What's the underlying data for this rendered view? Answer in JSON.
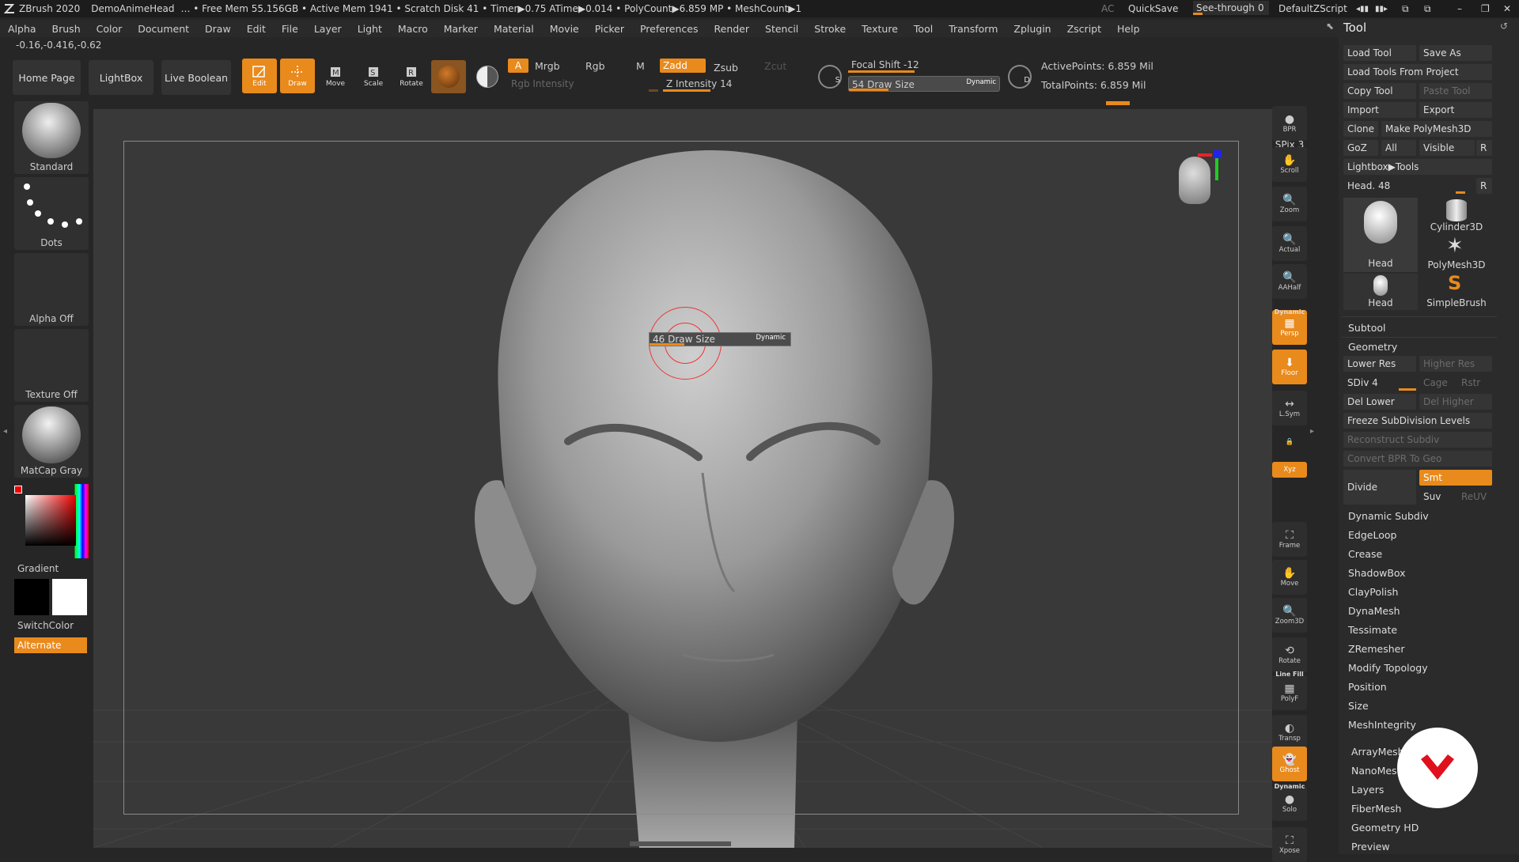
{
  "titlebar": {
    "app": "ZBrush 2020",
    "doc": "DemoAnimeHead",
    "stats": "… • Free Mem 55.156GB • Active Mem 1941 • Scratch Disk 41 • Timer▶0.75 ATime▶0.014 • PolyCount▶6.859 MP • MeshCount▶1",
    "ac": "AC",
    "quicksave": "QuickSave",
    "seethrough": "See-through",
    "seethrough_value": "0",
    "script": "DefaultZScript"
  },
  "menu": [
    "Alpha",
    "Brush",
    "Color",
    "Document",
    "Draw",
    "Edit",
    "File",
    "Layer",
    "Light",
    "Macro",
    "Marker",
    "Material",
    "Movie",
    "Picker",
    "Preferences",
    "Render",
    "Stencil",
    "Stroke",
    "Texture",
    "Tool",
    "Transform",
    "Zplugin",
    "Zscript",
    "Help"
  ],
  "coords": "-0.16,-0.416,-0.62",
  "shelf": {
    "home": "Home Page",
    "lightbox": "LightBox",
    "liveboolean": "Live Boolean",
    "edit": "Edit",
    "draw": "Draw",
    "move": "Move",
    "scale": "Scale",
    "rotate": "Rotate",
    "a": "A",
    "mrgb": "Mrgb",
    "rgb": "Rgb",
    "m": "M",
    "zadd": "Zadd",
    "zsub": "Zsub",
    "zcut": "Zcut",
    "rgb_intensity": "Rgb Intensity",
    "z_intensity": "Z Intensity 14",
    "focal_shift": "Focal Shift -12",
    "draw_size": "54 Draw Size",
    "dynamic": "Dynamic",
    "active_points": "ActivePoints: 6.859 Mil",
    "total_points": "TotalPoints: 6.859 Mil",
    "s": "S",
    "d": "D"
  },
  "left": {
    "standard": "Standard",
    "dots": "Dots",
    "alpha_off": "Alpha Off",
    "texture_off": "Texture Off",
    "matcap": "MatCap Gray",
    "gradient": "Gradient",
    "switchcolor": "SwitchColor",
    "alternate": "Alternate"
  },
  "brush_hud": {
    "label": "46 Draw Size",
    "dynamic": "Dynamic"
  },
  "rightbar": [
    "BPR",
    "Scroll",
    "Zoom",
    "Actual",
    "AAHalf",
    "Persp",
    "Floor",
    "L.Sym",
    "",
    "Xyz",
    "Frame",
    "Move",
    "Zoom3D",
    "Rotate",
    "PolyF",
    "Transp",
    "Ghost",
    "Solo",
    "Xpose"
  ],
  "rightbar_extra": {
    "spix": "SPix 3",
    "dynamic_top": "Dynamic",
    "linefill": "Line Fill"
  },
  "tool": {
    "header": "Tool",
    "load_tool": "Load Tool",
    "save_as": "Save As",
    "load_from_project": "Load Tools From Project",
    "copy_tool": "Copy Tool",
    "paste_tool": "Paste Tool",
    "import": "Import",
    "export": "Export",
    "clone": "Clone",
    "make_polymesh": "Make PolyMesh3D",
    "goz": "GoZ",
    "all": "All",
    "visible": "Visible",
    "r": "R",
    "lightbox_tools": "Lightbox▶Tools",
    "head_slider": "Head. 48",
    "thumbs": [
      "Head",
      "Cylinder3D",
      "PolyMesh3D",
      "Head",
      "SimpleBrush"
    ],
    "subtool": "Subtool",
    "geometry": "Geometry",
    "lower_res": "Lower Res",
    "higher_res": "Higher Res",
    "sdiv": "SDiv 4",
    "cage": "Cage",
    "rstr": "Rstr",
    "del_lower": "Del Lower",
    "del_higher": "Del Higher",
    "freeze": "Freeze SubDivision Levels",
    "reconstruct": "Reconstruct Subdiv",
    "convert_bpr": "Convert BPR To Geo",
    "divide": "Divide",
    "smt": "Smt",
    "suv": "Suv",
    "reuv": "ReUV",
    "geo_items": [
      "Dynamic Subdiv",
      "EdgeLoop",
      "Crease",
      "ShadowBox",
      "ClayPolish",
      "DynaMesh",
      "Tessimate",
      "ZRemesher",
      "Modify Topology",
      "Position",
      "Size",
      "MeshIntegrity"
    ],
    "sections": [
      "ArrayMesh",
      "NanoMesh",
      "Layers",
      "FiberMesh",
      "Geometry HD",
      "Preview"
    ]
  },
  "colors": {
    "accent": "#e98a1c",
    "panel": "#2b2b2b",
    "viewport": "#393939"
  }
}
